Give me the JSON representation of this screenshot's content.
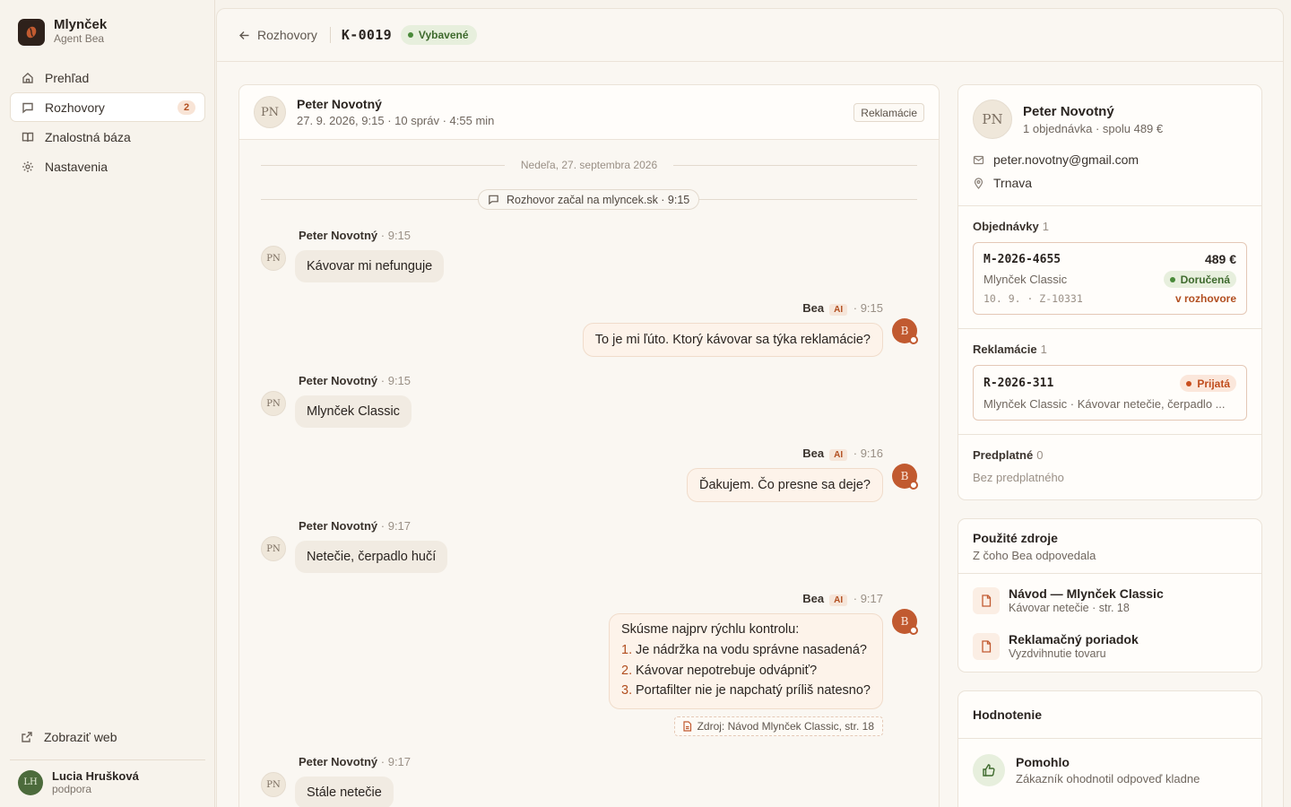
{
  "brand": {
    "name": "Mlynček",
    "subtitle": "Agent Bea"
  },
  "nav": [
    {
      "label": "Prehľad",
      "icon": "home-icon"
    },
    {
      "label": "Rozhovory",
      "icon": "chat-icon",
      "badge": "2",
      "active": true
    },
    {
      "label": "Znalostná báza",
      "icon": "book-icon"
    },
    {
      "label": "Nastavenia",
      "icon": "gear-icon"
    }
  ],
  "sidebar_bottom": {
    "web_link": "Zobraziť web",
    "user": {
      "initials": "LH",
      "name": "Lucia Hrušková",
      "role": "podpora"
    }
  },
  "topbar": {
    "back_label": "Rozhovory",
    "ticket_id": "K-0019",
    "status": "Vybavené"
  },
  "conversation": {
    "avatar": "PN",
    "name": "Peter Novotný",
    "meta": "27. 9. 2026, 9:15 · 10 správ · 4:55 min",
    "tag": "Reklamácie",
    "day_label": "Nedeľa, 27. septembra 2026",
    "system_event": "Rozhovor začal na mlyncek.sk · 9:15",
    "messages": [
      {
        "from": "customer",
        "who": "Peter Novotný",
        "time": "9:15",
        "text": "Kávovar mi nefunguje"
      },
      {
        "from": "bea",
        "who": "Bea",
        "ai": "AI",
        "time": "9:15",
        "text": "To je mi ľúto. Ktorý kávovar sa týka reklamácie?"
      },
      {
        "from": "customer",
        "who": "Peter Novotný",
        "time": "9:15",
        "text": "Mlynček Classic"
      },
      {
        "from": "bea",
        "who": "Bea",
        "ai": "AI",
        "time": "9:16",
        "text": "Ďakujem. Čo presne sa deje?"
      },
      {
        "from": "customer",
        "who": "Peter Novotný",
        "time": "9:17",
        "text": "Netečie, čerpadlo hučí"
      },
      {
        "from": "bea",
        "who": "Bea",
        "ai": "AI",
        "time": "9:17",
        "text": "Skúsme najprv rýchlu kontrolu:",
        "list": [
          "Je nádržka na vodu správne nasadená?",
          "Kávovar nepotrebuje odvápniť?",
          "Portafilter nie je napchatý príliš natesno?"
        ],
        "source": "Zdroj: Návod Mlynček Classic, str. 18"
      },
      {
        "from": "customer",
        "who": "Peter Novotný",
        "time": "9:17",
        "text": "Stále netečie"
      }
    ],
    "bea_initial": "B"
  },
  "customer_card": {
    "avatar": "PN",
    "name": "Peter Novotný",
    "summary": "1 objednávka · spolu 489 €",
    "email": "peter.novotny@gmail.com",
    "city": "Trnava",
    "orders": {
      "title": "Objednávky",
      "count": "1",
      "item": {
        "id": "M-2026-4655",
        "price": "489 €",
        "product": "Mlynček Classic",
        "status": "Doručená",
        "meta": "10. 9. · Z-10331",
        "link": "v rozhovore"
      }
    },
    "claims": {
      "title": "Reklamácie",
      "count": "1",
      "item": {
        "id": "R-2026-311",
        "status": "Prijatá",
        "desc": "Mlynček Classic · Kávovar netečie, čerpadlo ..."
      }
    },
    "subscription": {
      "title": "Predplatné",
      "count": "0",
      "empty": "Bez predplatného"
    }
  },
  "sources_card": {
    "title": "Použité zdroje",
    "subtitle": "Z čoho Bea odpovedala",
    "items": [
      {
        "title": "Návod — Mlynček Classic",
        "sub": "Kávovar netečie · str. 18"
      },
      {
        "title": "Reklamačný poriadok",
        "sub": "Vyzdvihnutie tovaru"
      }
    ]
  },
  "rating_card": {
    "title": "Hodnotenie",
    "result": "Pomohlo",
    "desc": "Zákazník ohodnotil odpoveď kladne"
  },
  "colors": {
    "accent": "#c15a30",
    "green": "#3e6a2d",
    "background": "#f7f3ec"
  }
}
